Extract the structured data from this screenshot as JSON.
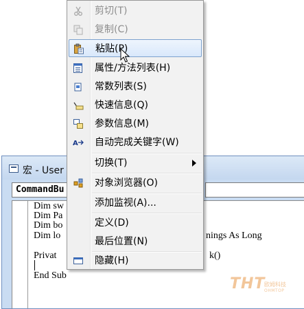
{
  "editor": {
    "title": "宏 - User",
    "object_combo": "CommandBu",
    "code": {
      "lines": [
        "Dim sw",
        "Dim Pa",
        "Dim bo",
        "Dim lo",
        "",
        "Privat",
        "",
        "End Sub"
      ],
      "line4_tail": "nings As Long",
      "line6_tail": "k()"
    }
  },
  "context_menu": {
    "items": [
      {
        "label": "剪切(T)",
        "icon": "scissors-icon",
        "disabled": true
      },
      {
        "label": "复制(C)",
        "icon": "copy-icon",
        "disabled": true
      },
      {
        "label": "粘贴(P)",
        "icon": "paste-icon",
        "highlighted": true
      },
      {
        "label": "属性/方法列表(H)",
        "icon": "list-members-icon"
      },
      {
        "label": "常数列表(S)",
        "icon": "list-constants-icon"
      },
      {
        "label": "快速信息(Q)",
        "icon": "quick-info-icon"
      },
      {
        "label": "参数信息(M)",
        "icon": "parameter-info-icon"
      },
      {
        "label": "自动完成关键字(W)",
        "icon": "complete-word-icon"
      },
      {
        "label": "切换(T)",
        "icon": "",
        "submenu": true
      },
      {
        "label": "对象浏览器(O)",
        "icon": "object-browser-icon"
      },
      {
        "label": "添加监视(A)...",
        "icon": ""
      },
      {
        "label": "定义(D)",
        "icon": ""
      },
      {
        "label": "最后位置(N)",
        "icon": ""
      },
      {
        "label": "隐藏(H)",
        "icon": "hide-window-icon"
      }
    ]
  },
  "watermark": {
    "logo": "THT",
    "cn": "欧姆科技",
    "en": "OHMTOP"
  },
  "colors": {
    "highlight_border": "#7da2ce",
    "menu_bg": "#f2f2f2",
    "title_bar": "#c9dcf2"
  }
}
